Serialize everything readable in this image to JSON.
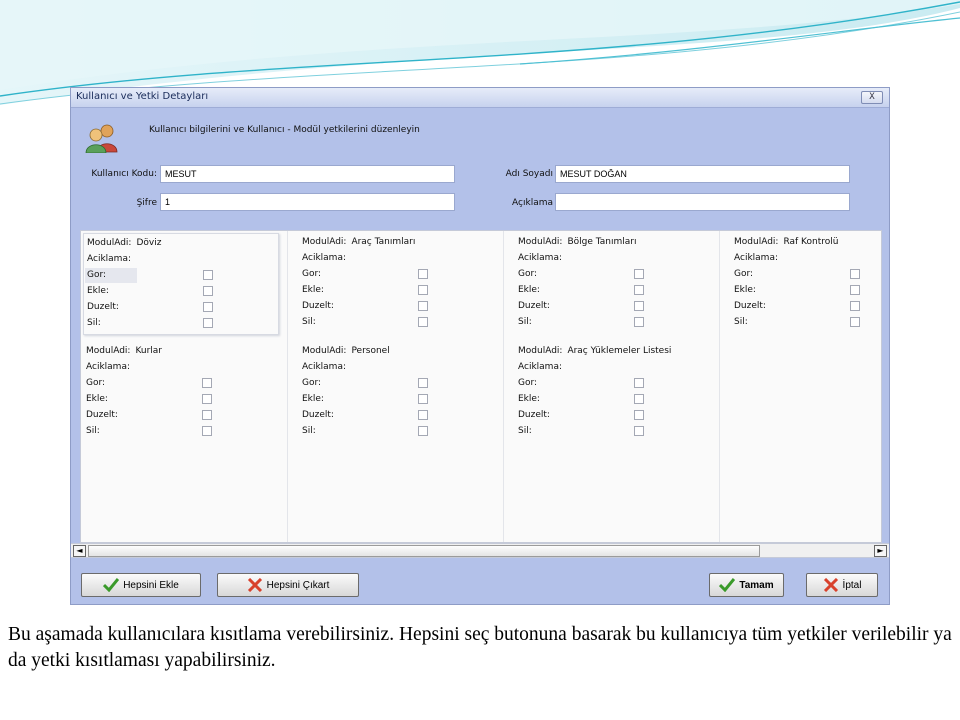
{
  "window": {
    "title": "Kullanıcı ve Yetki Detayları",
    "close_label": "X"
  },
  "header": {
    "text": "Kullanıcı bilgilerini ve Kullanıcı - Modül yetkilerini düzenleyin"
  },
  "form": {
    "kod_label": "Kullanıcı Kodu:",
    "kod_value": "MESUT",
    "sifre_label": "Şifre",
    "sifre_value": "1",
    "adsoyad_label": "Adı Soyadı",
    "adsoyad_value": "MESUT DOĞAN",
    "aciklama_label": "Açıklama",
    "aciklama_value": ""
  },
  "field_labels": {
    "modul_adi": "ModulAdi:",
    "aciklama": "Aciklama:",
    "gor": "Gor:",
    "ekle": "Ekle:",
    "duzelt": "Duzelt:",
    "sil": "Sil:"
  },
  "modules": [
    {
      "name": "Döviz",
      "gor": false,
      "ekle": false,
      "duzelt": false,
      "sil": false
    },
    {
      "name": "Araç Tanımları",
      "gor": false,
      "ekle": false,
      "duzelt": false,
      "sil": false
    },
    {
      "name": "Bölge Tanımları",
      "gor": false,
      "ekle": false,
      "duzelt": false,
      "sil": false
    },
    {
      "name": "Raf Kontrolü",
      "gor": false,
      "ekle": false,
      "duzelt": false,
      "sil": false
    },
    {
      "name": "Kurlar",
      "gor": false,
      "ekle": false,
      "duzelt": false,
      "sil": false
    },
    {
      "name": "Personel",
      "gor": false,
      "ekle": false,
      "duzelt": false,
      "sil": false
    },
    {
      "name": "Araç Yüklemeler Listesi",
      "gor": false,
      "ekle": false,
      "duzelt": false,
      "sil": false
    }
  ],
  "scrollbar": {
    "left_arrow": "◄",
    "right_arrow": "►"
  },
  "buttons": {
    "hepsini_ekle": "Hepsini Ekle",
    "hepsini_cikart": "Hepsini Çıkart",
    "tamam": "Tamam",
    "iptal": "İptal"
  },
  "caption": "Bu aşamada kullanıcılara kısıtlama verebilirsiniz. Hepsini seç butonuna basarak bu kullanıcıya tüm yetkiler  verilebilir ya da yetki kısıtlaması yapabilirsiniz.",
  "colors": {
    "window_bg": "#b3c1e9",
    "panel_bg": "#fafafa",
    "slide_accent": "#2fb3c9"
  }
}
